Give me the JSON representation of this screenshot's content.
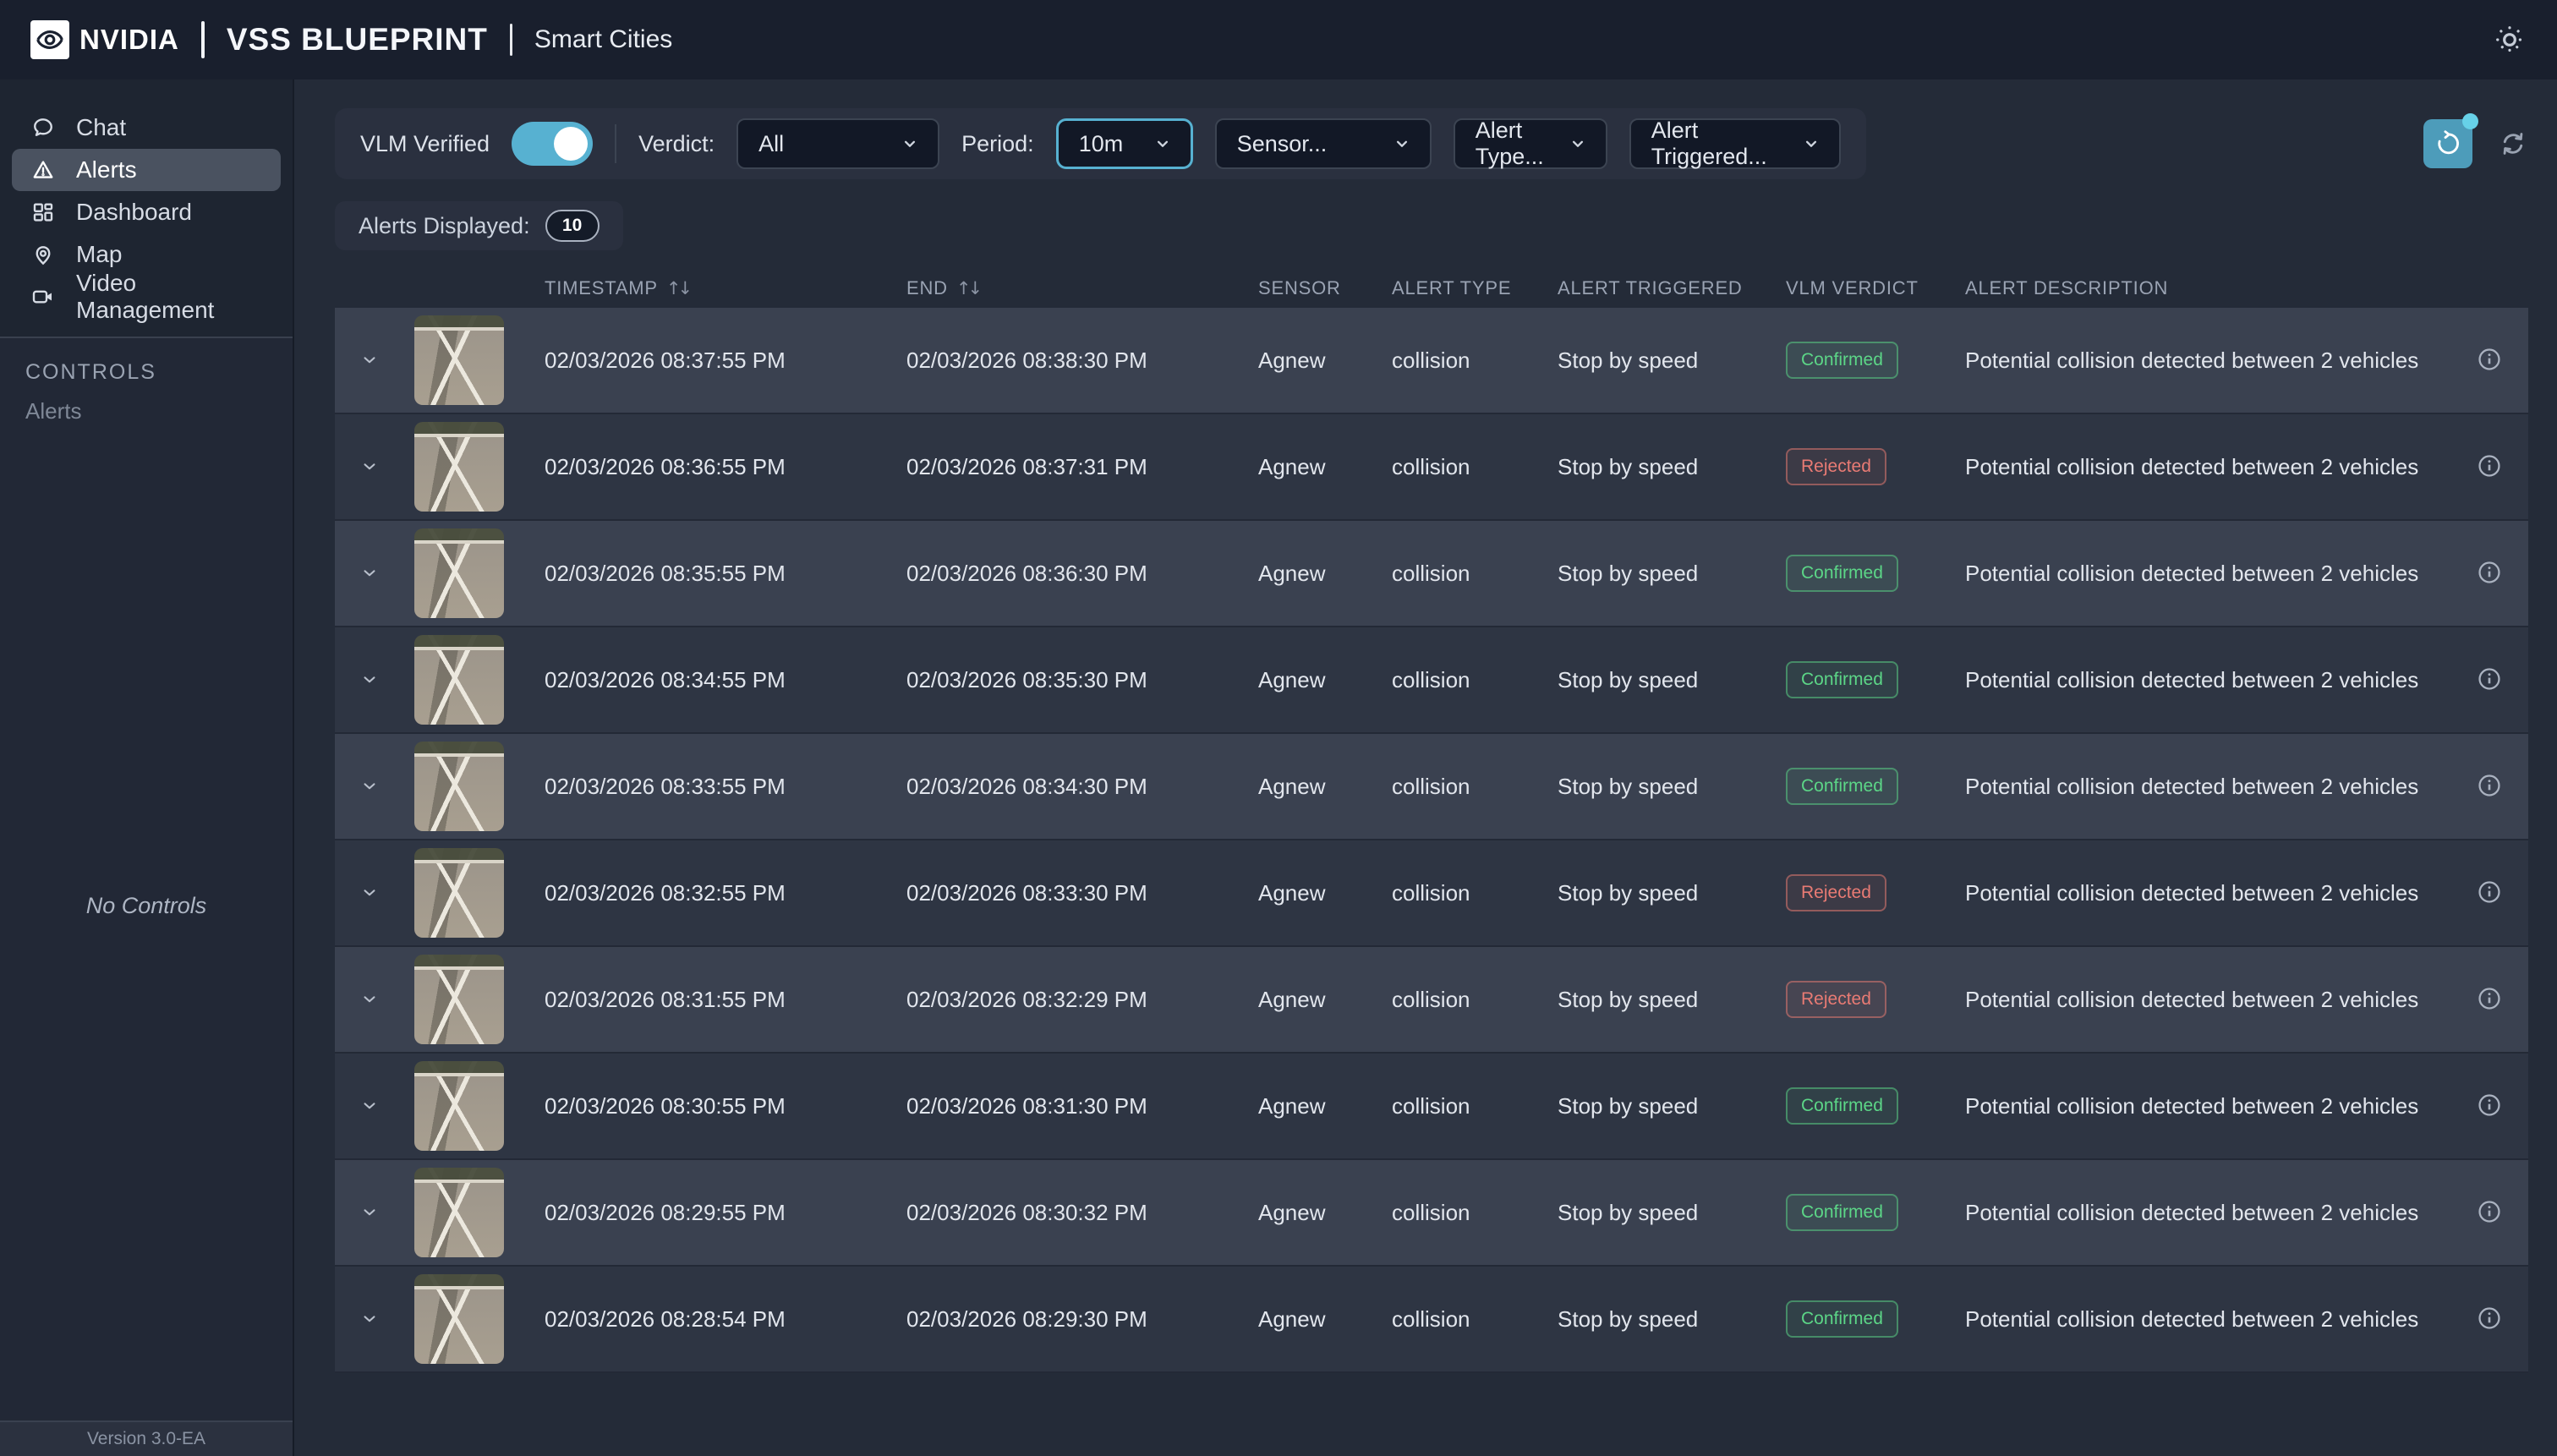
{
  "theme": {
    "accent": "#57b1d1",
    "confirmed": "#5cd687",
    "rejected": "#e97b74"
  },
  "header": {
    "brand": "NVIDIA",
    "product": "VSS BLUEPRINT",
    "subtitle": "Smart Cities"
  },
  "sidebar": {
    "items": [
      {
        "label": "Chat",
        "icon": "chat-icon",
        "active": false
      },
      {
        "label": "Alerts",
        "icon": "alert-triangle-icon",
        "active": true
      },
      {
        "label": "Dashboard",
        "icon": "dashboard-icon",
        "active": false
      },
      {
        "label": "Map",
        "icon": "map-pin-icon",
        "active": false
      },
      {
        "label": "Video Management",
        "icon": "video-camera-icon",
        "active": false
      }
    ],
    "controls_title": "CONTROLS",
    "controls_context": "Alerts",
    "empty_message": "No Controls",
    "version": "Version 3.0-EA"
  },
  "filters": {
    "vlm_verified_label": "VLM Verified",
    "vlm_verified_on": true,
    "verdict_label": "Verdict:",
    "verdict_value": "All",
    "period_label": "Period:",
    "period_value": "10m",
    "sensor_placeholder": "Sensor...",
    "alert_type_placeholder": "Alert Type...",
    "alert_triggered_placeholder": "Alert Triggered..."
  },
  "alerts_displayed": {
    "label": "Alerts Displayed:",
    "count": "10"
  },
  "table": {
    "columns": [
      "TIMESTAMP",
      "END",
      "SENSOR",
      "ALERT TYPE",
      "ALERT TRIGGERED",
      "VLM VERDICT",
      "ALERT DESCRIPTION"
    ],
    "rows": [
      {
        "timestamp": "02/03/2026 08:37:55 PM",
        "end": "02/03/2026 08:38:30 PM",
        "sensor": "Agnew",
        "alert_type": "collision",
        "alert_triggered": "Stop by speed",
        "verdict": "Confirmed",
        "description": "Potential collision detected between 2 vehicles"
      },
      {
        "timestamp": "02/03/2026 08:36:55 PM",
        "end": "02/03/2026 08:37:31 PM",
        "sensor": "Agnew",
        "alert_type": "collision",
        "alert_triggered": "Stop by speed",
        "verdict": "Rejected",
        "description": "Potential collision detected between 2 vehicles"
      },
      {
        "timestamp": "02/03/2026 08:35:55 PM",
        "end": "02/03/2026 08:36:30 PM",
        "sensor": "Agnew",
        "alert_type": "collision",
        "alert_triggered": "Stop by speed",
        "verdict": "Confirmed",
        "description": "Potential collision detected between 2 vehicles"
      },
      {
        "timestamp": "02/03/2026 08:34:55 PM",
        "end": "02/03/2026 08:35:30 PM",
        "sensor": "Agnew",
        "alert_type": "collision",
        "alert_triggered": "Stop by speed",
        "verdict": "Confirmed",
        "description": "Potential collision detected between 2 vehicles"
      },
      {
        "timestamp": "02/03/2026 08:33:55 PM",
        "end": "02/03/2026 08:34:30 PM",
        "sensor": "Agnew",
        "alert_type": "collision",
        "alert_triggered": "Stop by speed",
        "verdict": "Confirmed",
        "description": "Potential collision detected between 2 vehicles"
      },
      {
        "timestamp": "02/03/2026 08:32:55 PM",
        "end": "02/03/2026 08:33:30 PM",
        "sensor": "Agnew",
        "alert_type": "collision",
        "alert_triggered": "Stop by speed",
        "verdict": "Rejected",
        "description": "Potential collision detected between 2 vehicles"
      },
      {
        "timestamp": "02/03/2026 08:31:55 PM",
        "end": "02/03/2026 08:32:29 PM",
        "sensor": "Agnew",
        "alert_type": "collision",
        "alert_triggered": "Stop by speed",
        "verdict": "Rejected",
        "description": "Potential collision detected between 2 vehicles"
      },
      {
        "timestamp": "02/03/2026 08:30:55 PM",
        "end": "02/03/2026 08:31:30 PM",
        "sensor": "Agnew",
        "alert_type": "collision",
        "alert_triggered": "Stop by speed",
        "verdict": "Confirmed",
        "description": "Potential collision detected between 2 vehicles"
      },
      {
        "timestamp": "02/03/2026 08:29:55 PM",
        "end": "02/03/2026 08:30:32 PM",
        "sensor": "Agnew",
        "alert_type": "collision",
        "alert_triggered": "Stop by speed",
        "verdict": "Confirmed",
        "description": "Potential collision detected between 2 vehicles"
      },
      {
        "timestamp": "02/03/2026 08:28:54 PM",
        "end": "02/03/2026 08:29:30 PM",
        "sensor": "Agnew",
        "alert_type": "collision",
        "alert_triggered": "Stop by speed",
        "verdict": "Confirmed",
        "description": "Potential collision detected between 2 vehicles"
      }
    ]
  }
}
